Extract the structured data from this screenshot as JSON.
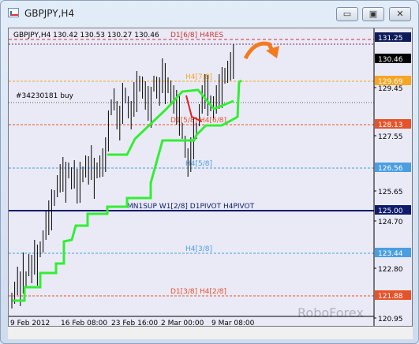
{
  "window": {
    "title": "GBPJPY,H4",
    "buttons": {
      "minimize": "▭",
      "maximize": "▣",
      "close": "✕"
    }
  },
  "chart": {
    "header_text": "GBPJPY,H4  130.42 130.53 130.27 130.46",
    "trade_label": "#34230181 buy",
    "watermark": "RoboForex",
    "price_labels": [
      {
        "text": "131.25",
        "bg": "#0d1b5a",
        "fg": "#ffffff"
      },
      {
        "text": "130.46",
        "bg": "#000000",
        "fg": "#ffffff"
      },
      {
        "text": "129.69",
        "bg": "#f5a623",
        "fg": "#ffffff"
      },
      {
        "text": "128.13",
        "bg": "#e5532a",
        "fg": "#ffffff"
      },
      {
        "text": "126.56",
        "bg": "#4b9fe0",
        "fg": "#ffffff"
      },
      {
        "text": "125.00",
        "bg": "#0d1b6a",
        "fg": "#ffffff"
      },
      {
        "text": "123.44",
        "bg": "#4b9fe0",
        "fg": "#ffffff"
      },
      {
        "text": "121.88",
        "bg": "#e5532a",
        "fg": "#ffffff"
      }
    ],
    "axis_labels": [
      "129.45",
      "127.55",
      "125.65",
      "124.70",
      "122.80",
      "120.95"
    ],
    "x_labels": [
      "9 Feb 2012",
      "16 Feb 08:00",
      "23 Feb 16:00",
      "2 Mar 00:00",
      "9 Mar 08:00"
    ],
    "level_labels": [
      "D1[6/8] H4RES",
      "H4[7/8]",
      "D1[5/8] H4[6/8]",
      "H4[5/8]",
      "MN1SUP W1[2/8] D1PIVOT H4PIVOT",
      "H4[3/8]",
      "D1[3/8] H4[2/8]"
    ]
  }
}
